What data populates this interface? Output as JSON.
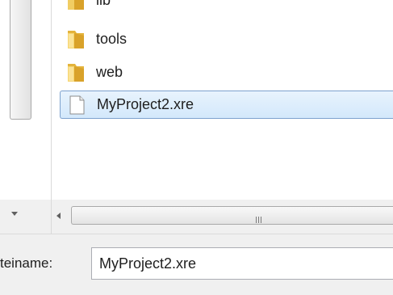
{
  "file_list": {
    "items": [
      {
        "label": "lib",
        "icon": "folder-icon",
        "selected": false
      },
      {
        "label": "tools",
        "icon": "folder-icon",
        "selected": false
      },
      {
        "label": "web",
        "icon": "folder-icon",
        "selected": false
      },
      {
        "label": "MyProject2.xre",
        "icon": "file-icon",
        "selected": true
      }
    ]
  },
  "hscroll": {
    "grip_icon": "grip-icon",
    "left_arrow_icon": "arrow-left-icon"
  },
  "nav_pane": {
    "down_arrow_icon": "arrow-down-icon"
  },
  "filename": {
    "label": "teiname:",
    "value": "MyProject2.xre"
  },
  "colors": {
    "selection_border": "#7da2ce",
    "selection_fill": "#d3e8fb",
    "folder_yellow": "#e9c14c"
  }
}
